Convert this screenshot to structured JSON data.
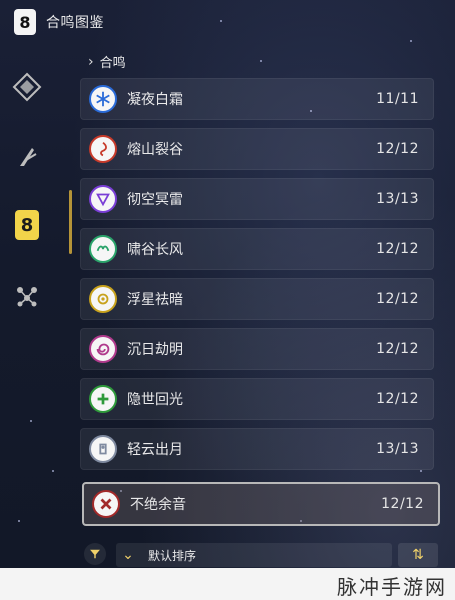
{
  "header": {
    "app_icon_glyph": "8",
    "title": "合鸣图鉴"
  },
  "sidebar": {
    "items": [
      {
        "id": "diamond",
        "icon": "diamond-icon"
      },
      {
        "id": "feather",
        "icon": "feather-icon"
      },
      {
        "id": "sonata",
        "icon": "sonata-icon",
        "active": true
      },
      {
        "id": "nodes",
        "icon": "nodes-icon"
      }
    ]
  },
  "breadcrumb": {
    "label": "合鸣"
  },
  "list": {
    "items": [
      {
        "name": "凝夜白霜",
        "count": "11/11",
        "icon": "snowflake-icon",
        "color": "#2a6bd8"
      },
      {
        "name": "熔山裂谷",
        "count": "12/12",
        "icon": "flame-swirl-icon",
        "color": "#c73a2a"
      },
      {
        "name": "彻空冥雷",
        "count": "13/13",
        "icon": "thunder-icon",
        "color": "#7a3ed6"
      },
      {
        "name": "啸谷长风",
        "count": "12/12",
        "icon": "wind-icon",
        "color": "#2aa36a"
      },
      {
        "name": "浮星祛暗",
        "count": "12/12",
        "icon": "star-icon",
        "color": "#c8a21c"
      },
      {
        "name": "沉日劫明",
        "count": "12/12",
        "icon": "spiral-icon",
        "color": "#b03a8c"
      },
      {
        "name": "隐世回光",
        "count": "12/12",
        "icon": "plus-icon",
        "color": "#2e9a3a"
      },
      {
        "name": "轻云出月",
        "count": "13/13",
        "icon": "moon-icon",
        "color": "#7f8aa0"
      },
      {
        "name": "不绝余音",
        "count": "12/12",
        "icon": "crossed-swords-icon",
        "color": "#a22a2a",
        "selected": true
      }
    ]
  },
  "footer": {
    "sort_label": "默认排序",
    "sort_caret": "⌄",
    "sort_button": "⇅"
  },
  "watermark": {
    "text": "脉冲手游网"
  }
}
